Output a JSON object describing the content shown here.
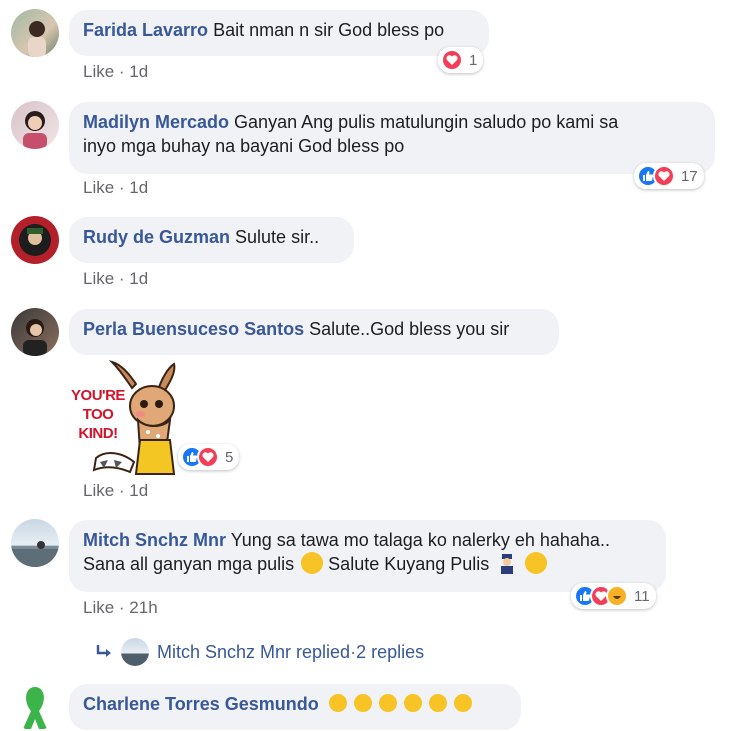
{
  "comments": [
    {
      "author": "Farida Lavarro",
      "text": "Bait nman n sir God bless po",
      "like_label": "Like",
      "time": "1d",
      "reaction_count": "1"
    },
    {
      "author": "Madilyn Mercado",
      "text_line1": "Ganyan Ang pulis matulungin saludo po kami sa",
      "text_line2": "inyo mga buhay na bayani God bless po",
      "like_label": "Like",
      "time": "1d",
      "reaction_count": "17"
    },
    {
      "author": "Rudy de Guzman",
      "text": "Sulute sir..",
      "like_label": "Like",
      "time": "1d"
    },
    {
      "author": "Perla Buensuceso Santos",
      "text": "Salute..God bless you sir",
      "sticker_text": "YOU'RE TOO KIND!",
      "like_label": "Like",
      "time": "1d",
      "reaction_count": "5"
    },
    {
      "author": "Mitch Snchz Mnr",
      "text_line1": "Yung sa tawa mo talaga ko nalerky eh hahaha..",
      "text_line2": "Sana all ganyan mga pulis",
      "text_line2b": "Salute Kuyang Pulis",
      "like_label": "Like",
      "time": "21h",
      "reaction_count": "11",
      "replies_author": "Mitch Snchz Mnr replied",
      "replies_count": "2 replies"
    },
    {
      "author": "Charlene Torres Gesmundo"
    }
  ],
  "separator": " · ",
  "colors": {
    "author": "#385898",
    "bubble": "#f0f2f5",
    "meta": "#65676b",
    "like_reaction": "#1877f2",
    "heart_reaction": "#f33e58",
    "haha_reaction": "#f7b125"
  }
}
